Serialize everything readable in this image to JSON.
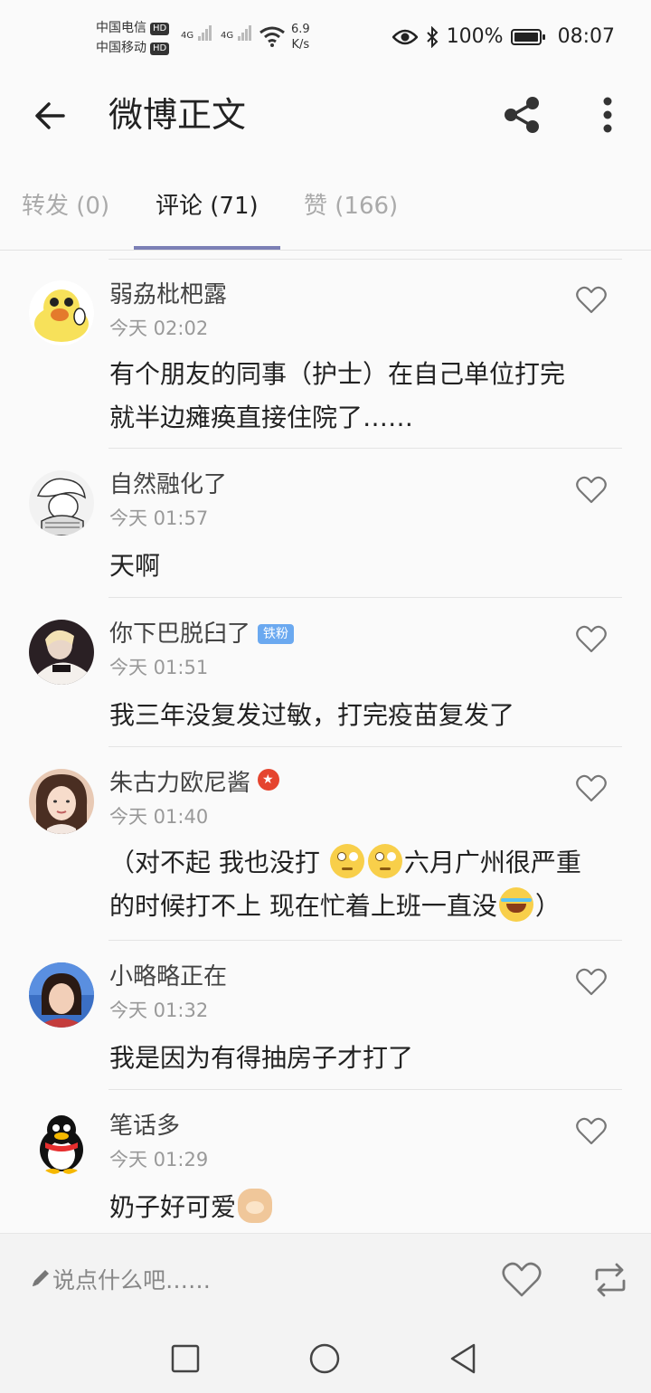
{
  "status_bar": {
    "carrier1": "中国电信",
    "carrier2": "中国移动",
    "hd": "HD",
    "net1": "4G",
    "net2": "4G",
    "speed_value": "6.9",
    "speed_unit": "K/s",
    "battery": "100%",
    "time": "08:07"
  },
  "header": {
    "title": "微博正文"
  },
  "tabs": [
    {
      "label": "转发 (0)",
      "active": false
    },
    {
      "label": "评论 (71)",
      "active": true
    },
    {
      "label": "赞 (166)",
      "active": false
    }
  ],
  "comments": [
    {
      "user": "弱劦枇杷露",
      "time": "今天 02:02",
      "text_lines": [
        "有个朋友的同事（护士）在自己单位打完",
        "就半边瘫痪直接住院了……"
      ]
    },
    {
      "user": "自然融化了",
      "time": "今天 01:57",
      "text_lines": [
        "天啊"
      ]
    },
    {
      "user": "你下巴脱臼了",
      "badge": "铁粉",
      "time": "今天 01:51",
      "text_lines": [
        "我三年没复发过敏，打完疫苗复发了"
      ]
    },
    {
      "user": "朱古力欧尼酱",
      "time": "今天 01:40",
      "text_parts": {
        "a": "（对不起 我也没打 ",
        "b": "六月广州很严重",
        "c": "的时候打不上 现在忙着上班一直没",
        "d": "）"
      }
    },
    {
      "user": "小略略正在",
      "time": "今天 01:32",
      "text_lines": [
        "我是因为有得抽房子才打了"
      ]
    },
    {
      "user": "笔话多",
      "time": "今天 01:29",
      "text_lines": [
        "奶子好可爱"
      ]
    }
  ],
  "input_bar": {
    "placeholder": "说点什么吧……"
  },
  "colors": {
    "tab_indicator": "#7b7fb5",
    "fan_badge": "#6ba9f0",
    "verified_badge": "#e5452f"
  }
}
